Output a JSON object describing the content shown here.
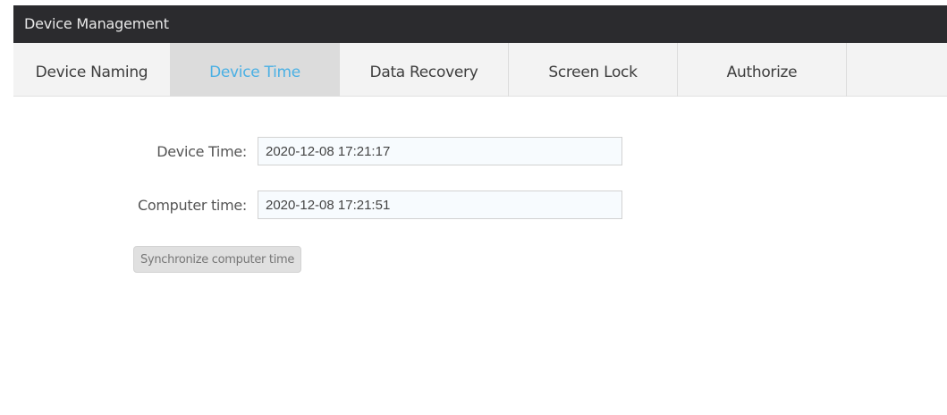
{
  "header": {
    "title": "Device Management"
  },
  "tabs": [
    {
      "label": "Device Naming",
      "active": false
    },
    {
      "label": "Device Time",
      "active": true
    },
    {
      "label": "Data Recovery",
      "active": false
    },
    {
      "label": "Screen Lock",
      "active": false
    },
    {
      "label": "Authorize",
      "active": false
    }
  ],
  "form": {
    "device_time": {
      "label": "Device Time:",
      "value": "2020-12-08 17:21:17"
    },
    "computer_time": {
      "label": "Computer time:",
      "value": "2020-12-08 17:21:51"
    },
    "sync_button_label": "Synchronize computer time"
  },
  "colors": {
    "header_bg": "#2b2b2e",
    "tab_active_text": "#4ab0e4",
    "tab_active_bg": "#dcdcdc",
    "tabbar_bg": "#f3f3f3"
  }
}
